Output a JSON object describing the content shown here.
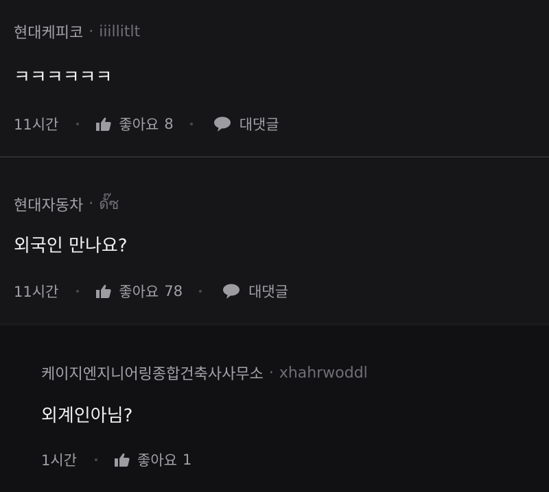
{
  "comments": [
    {
      "author": "현대케피코",
      "separator": "·",
      "handle": "iiillitlt",
      "text": "ㅋㅋㅋㅋㅋㅋ",
      "time": "11시간",
      "like_label": "좋아요",
      "like_count": "8",
      "reply_label": "대댓글"
    },
    {
      "author": "현대자동차",
      "separator": "·",
      "handle": "ดั๊ซ",
      "text": "외국인 만나요?",
      "time": "11시간",
      "like_label": "좋아요",
      "like_count": "78",
      "reply_label": "대댓글"
    },
    {
      "author": "케이지엔지니어링종합건축사사무소",
      "separator": "·",
      "handle": "xhahrwoddl",
      "text": "외계인아님?",
      "time": "1시간",
      "like_label": "좋아요",
      "like_count": "1"
    }
  ],
  "icons": {
    "like": "thumbs-up-icon",
    "reply": "speech-bubble-icon"
  },
  "colors": {
    "background": "#161618",
    "reply_background": "#111113",
    "text": "#f0f0f2",
    "muted": "#8d8d92"
  }
}
